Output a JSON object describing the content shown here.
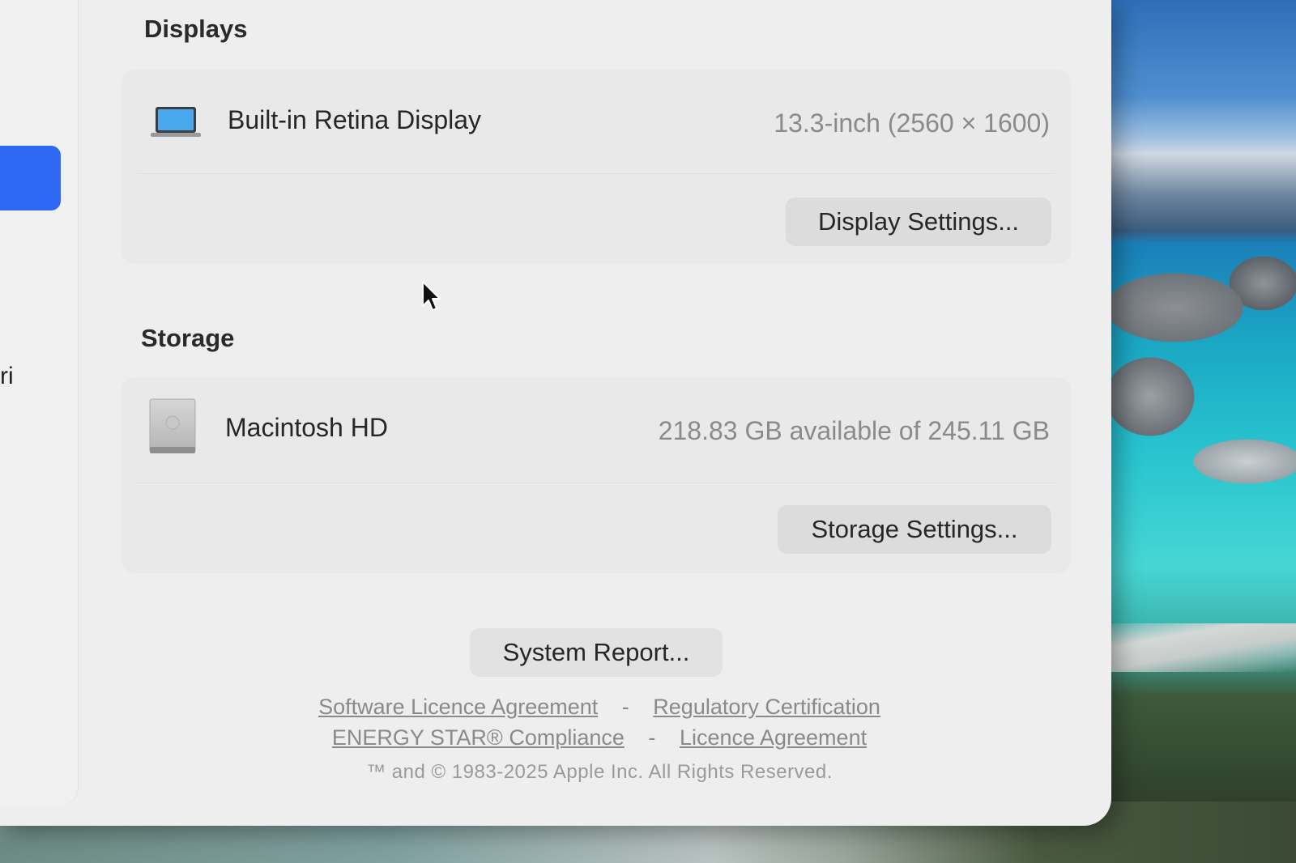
{
  "sidebar": {
    "partial_label": "ri"
  },
  "displays": {
    "section_title": "Displays",
    "item_name": "Built-in Retina Display",
    "item_value": "13.3-inch (2560 × 1600)",
    "button_label": "Display Settings...",
    "icon": "laptop-icon"
  },
  "storage": {
    "section_title": "Storage",
    "item_name": "Macintosh HD",
    "item_value": "218.83 GB available of 245.11 GB",
    "button_label": "Storage Settings...",
    "icon": "hard-drive-icon"
  },
  "system_report": {
    "label": "System Report..."
  },
  "footer": {
    "links_row1": [
      "Software Licence Agreement",
      "Regulatory Certification"
    ],
    "links_row2": [
      "ENERGY STAR® Compliance",
      "Licence Agreement"
    ],
    "separator": "-",
    "copyright": "™ and © 1983-2025 Apple Inc. All Rights Reserved."
  },
  "colors": {
    "accent": "#2f68f3",
    "window_bg": "#eeeeee",
    "card_bg": "#e9e9e9",
    "button_bg": "#dcdcdc"
  }
}
